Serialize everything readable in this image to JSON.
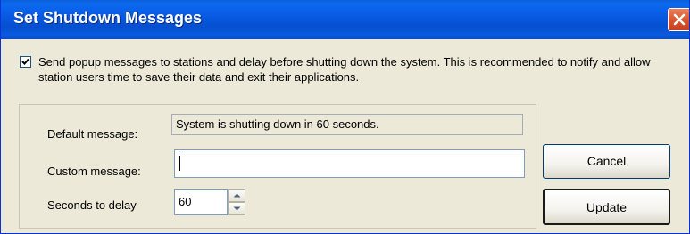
{
  "window": {
    "title": "Set Shutdown Messages"
  },
  "options": {
    "send_popup_checked": true,
    "send_popup_label": "Send popup messages to stations and delay before shutting down the system. This is recommended to notify and allow station users time to save their data and exit their applications."
  },
  "form": {
    "default_message_label": "Default message:",
    "default_message_value": "System is shutting down in 60 seconds.",
    "custom_message_label": "Custom message:",
    "custom_message_value": "",
    "seconds_label": "Seconds to delay",
    "seconds_value": "60"
  },
  "buttons": {
    "cancel": "Cancel",
    "update": "Update"
  },
  "icons": {
    "close": "close-icon",
    "check": "check-icon",
    "spin_up": "arrow-up-icon",
    "spin_down": "arrow-down-icon"
  },
  "colors": {
    "titlebar": "#0A5FD8",
    "close_button": "#d8532c",
    "dialog_background": "#ECE9D8"
  }
}
